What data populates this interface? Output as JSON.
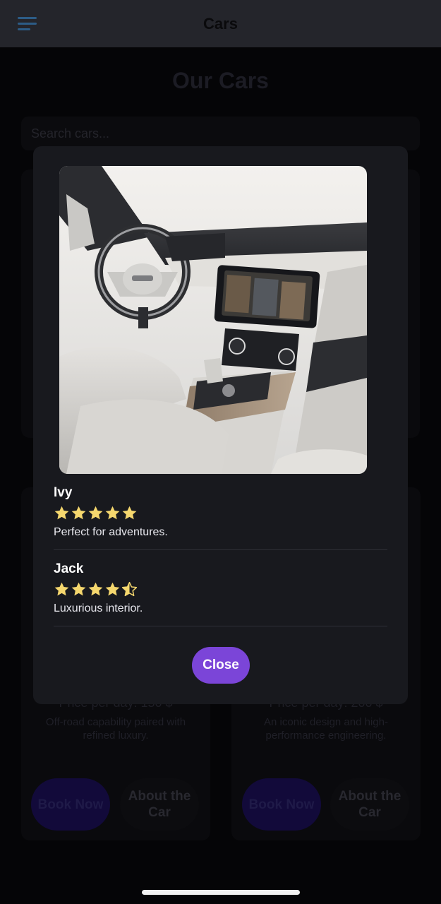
{
  "header": {
    "title": "Cars",
    "menu_icon": "hamburger-menu-icon"
  },
  "page": {
    "title": "Our Cars",
    "search_placeholder": "Search cars..."
  },
  "cards": [
    {
      "price": "Price per day: 150 $",
      "description": "Off-road capability paired with refined luxury.",
      "book_label": "Book Now",
      "about_label": "About the Car"
    },
    {
      "price": "Price per day: 200 $",
      "description": "An iconic design and high-performance engineering.",
      "book_label": "Book Now",
      "about_label": "About the Car"
    }
  ],
  "modal": {
    "image": "car-interior-photo",
    "reviews": [
      {
        "name": "Ivy",
        "rating": 5,
        "text": "Perfect for adventures."
      },
      {
        "name": "Jack",
        "rating": 4.5,
        "text": "Luxurious interior."
      }
    ],
    "close_label": "Close"
  },
  "colors": {
    "accent": "#7b45d8",
    "star": "#f5d76e",
    "header_bg": "#24252b",
    "modal_bg": "#18191e"
  }
}
